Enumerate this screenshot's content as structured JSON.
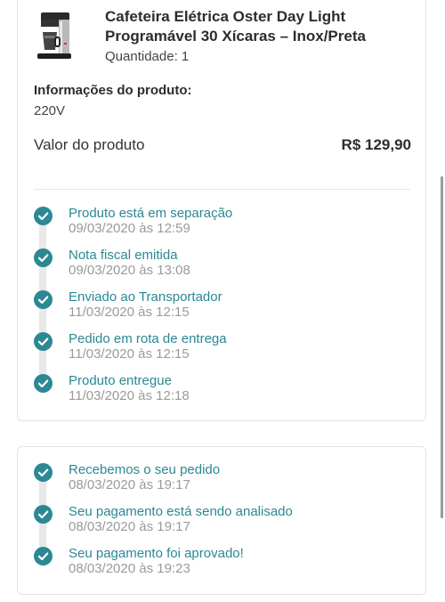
{
  "product": {
    "name": "Cafeteira Elétrica Oster Day Light Programável 30 Xícaras – Inox/Preta",
    "quantity": "Quantidade: 1",
    "info_heading": "Informações do produto:",
    "info_value": "220V",
    "value_label": "Valor do produto",
    "value_price": "R$ 129,90"
  },
  "colors": {
    "accent": "#2b8894",
    "date_gray": "#9a9a9a",
    "rail": "#e8e8e8"
  },
  "shipping_timeline": [
    {
      "title": "Produto está em separação",
      "date": "09/03/2020 às 12:59",
      "icon": "check-circle-icon"
    },
    {
      "title": "Nota fiscal emitida",
      "date": "09/03/2020 às 13:08",
      "icon": "check-circle-icon"
    },
    {
      "title": "Enviado ao Transportador",
      "date": "11/03/2020 às 12:15",
      "icon": "check-circle-icon"
    },
    {
      "title": "Pedido em rota de entrega",
      "date": "11/03/2020 às 12:15",
      "icon": "check-circle-icon"
    },
    {
      "title": "Produto entregue",
      "date": "11/03/2020 às 12:18",
      "icon": "check-circle-icon"
    }
  ],
  "order_timeline": [
    {
      "title": "Recebemos o seu pedido",
      "date": "08/03/2020 às 19:17",
      "icon": "check-circle-icon"
    },
    {
      "title": "Seu pagamento está sendo analisado",
      "date": "08/03/2020 às 19:17",
      "icon": "check-circle-icon"
    },
    {
      "title": "Seu pagamento foi aprovado!",
      "date": "08/03/2020 às 19:23",
      "icon": "check-circle-icon"
    }
  ]
}
